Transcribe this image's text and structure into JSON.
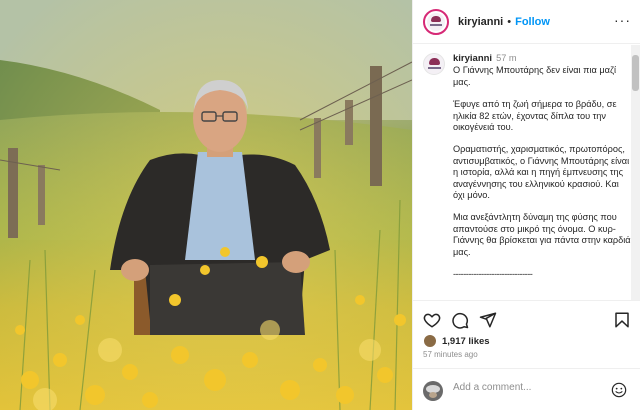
{
  "account": {
    "username": "kiryianni",
    "separator": "•",
    "follow_label": "Follow",
    "more_label": "···"
  },
  "post": {
    "caption_user": "kiryianni",
    "time_short": "57 m",
    "paragraphs": [
      "Ο Γιάννης Μπουτάρης δεν είναι πια μαζί μας.",
      "Έφυγε από τη ζωή σήμερα το βράδυ, σε ηλικία 82 ετών, έχοντας δίπλα του την οικογένειά του.",
      "Οραματιστής, χαρισματικός, πρωτοπόρος, αντισυμβατικός, ο Γιάννης Μπουτάρης είναι η ιστορία, αλλά και η πηγή έμπνευσης της αναγέννησης του ελληνικού κρασιού. Και όχι μόνο.",
      "Μια ανεξάντλητη δύναμη της φύσης που απαντούσε στο μικρό της όνομα. Ο κυρ-Γιάννης θα βρίσκεται για πάντα στην καρδιά μας."
    ],
    "divider": "-------------------------------",
    "likes": "1,917 likes",
    "time_ago": "57 minutes ago"
  },
  "icons": {
    "like": "heart-icon",
    "comment": "comment-icon",
    "share": "share-icon",
    "save": "bookmark-icon",
    "emoji": "emoji-icon"
  },
  "comment": {
    "placeholder": "Add a comment..."
  },
  "colors": {
    "follow": "#0095f6",
    "muted": "#8e8e8e",
    "ring": "#d62976"
  }
}
